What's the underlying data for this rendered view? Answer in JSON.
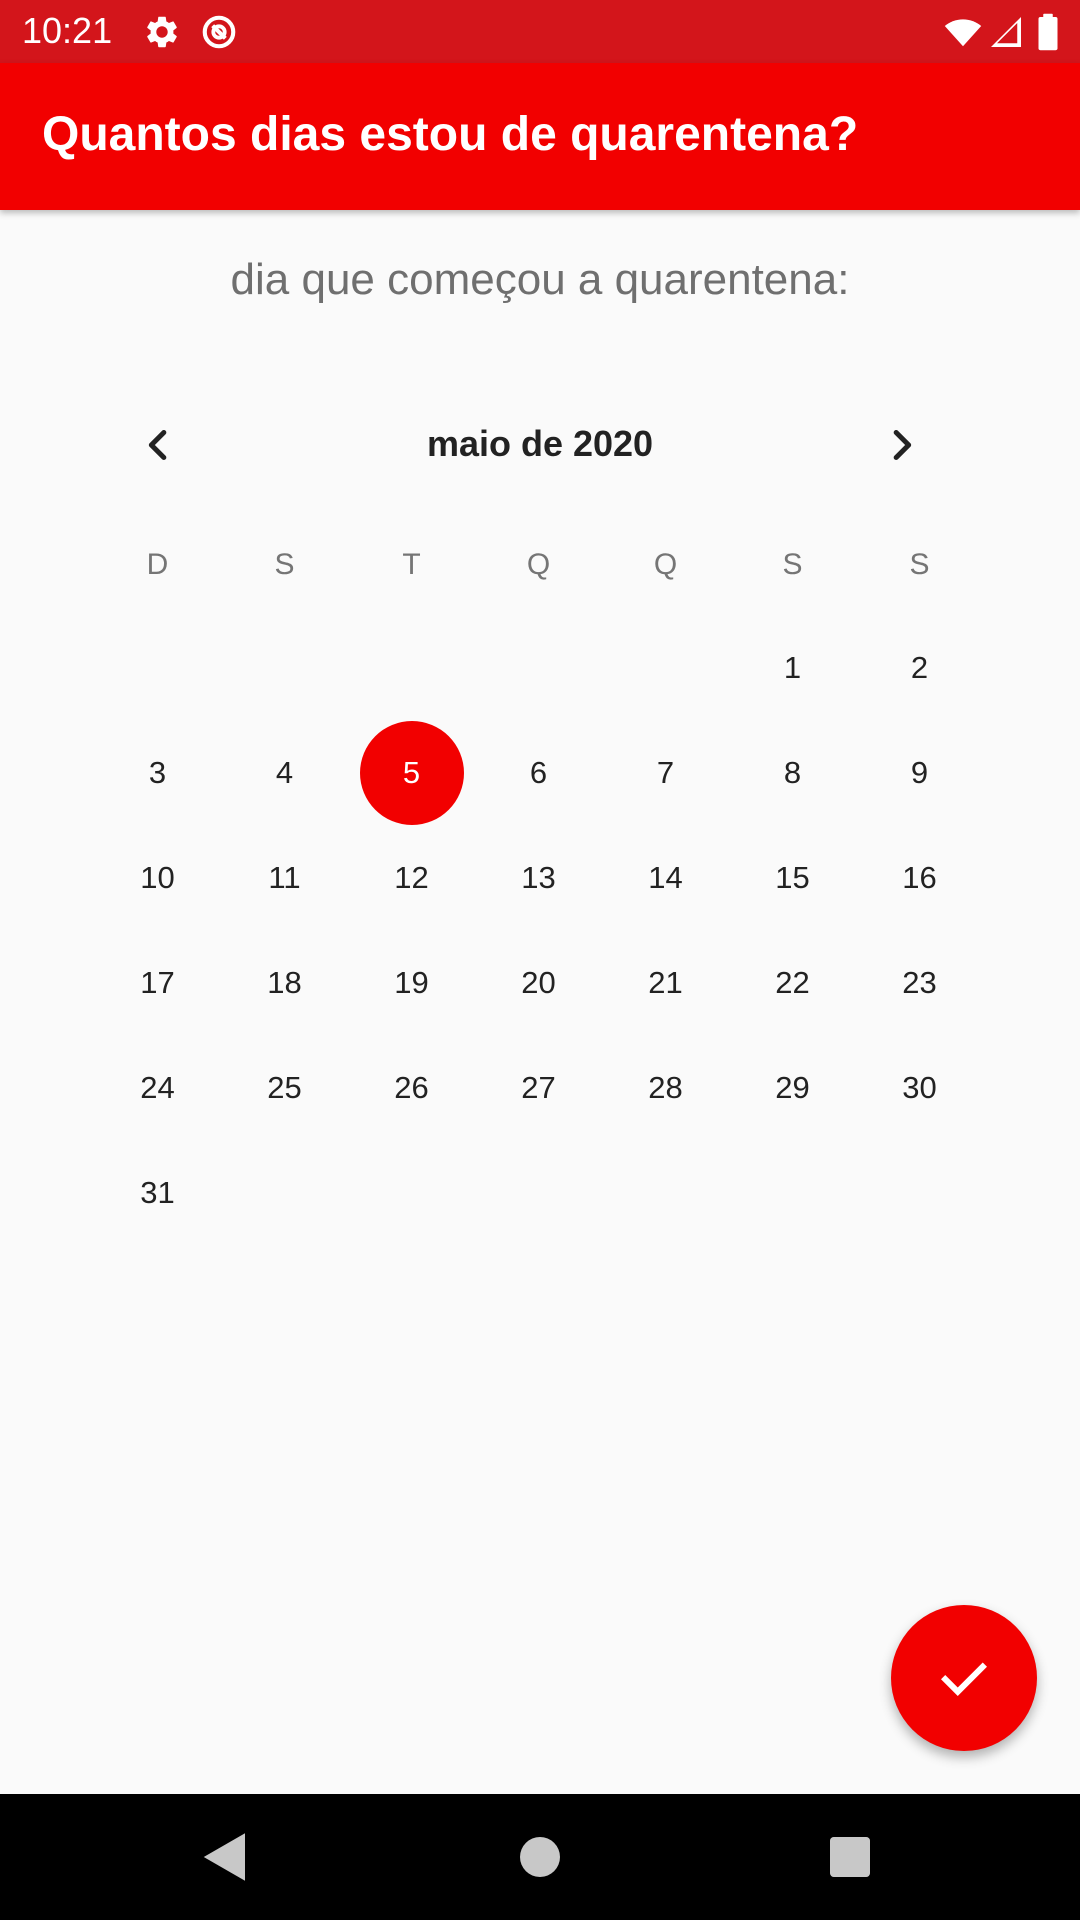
{
  "status_bar": {
    "time": "10:21",
    "icons": [
      "settings-gear-icon",
      "blocked-circle-icon",
      "wifi-icon",
      "signal-icon",
      "battery-icon"
    ],
    "background": "#d3151b"
  },
  "app_bar": {
    "title": "Quantos dias estou de quarentena?",
    "background": "#f20000"
  },
  "prompt": "dia que começou a quarentena:",
  "calendar": {
    "month_label": "maio de 2020",
    "prev_icon": "chevron-left-icon",
    "next_icon": "chevron-right-icon",
    "weekdays": [
      "D",
      "S",
      "T",
      "Q",
      "Q",
      "S",
      "S"
    ],
    "selected_day": "5",
    "selected_color": "#f20000",
    "weeks": [
      [
        "",
        "",
        "",
        "",
        "",
        "1",
        "2"
      ],
      [
        "3",
        "4",
        "5",
        "6",
        "7",
        "8",
        "9"
      ],
      [
        "10",
        "11",
        "12",
        "13",
        "14",
        "15",
        "16"
      ],
      [
        "17",
        "18",
        "19",
        "20",
        "21",
        "22",
        "23"
      ],
      [
        "24",
        "25",
        "26",
        "27",
        "28",
        "29",
        "30"
      ],
      [
        "31",
        "",
        "",
        "",
        "",
        "",
        ""
      ]
    ]
  },
  "fab": {
    "icon": "check-icon",
    "color": "#f20000"
  },
  "nav_bar": {
    "buttons": [
      "back-triangle-icon",
      "home-circle-icon",
      "recents-square-icon"
    ]
  }
}
